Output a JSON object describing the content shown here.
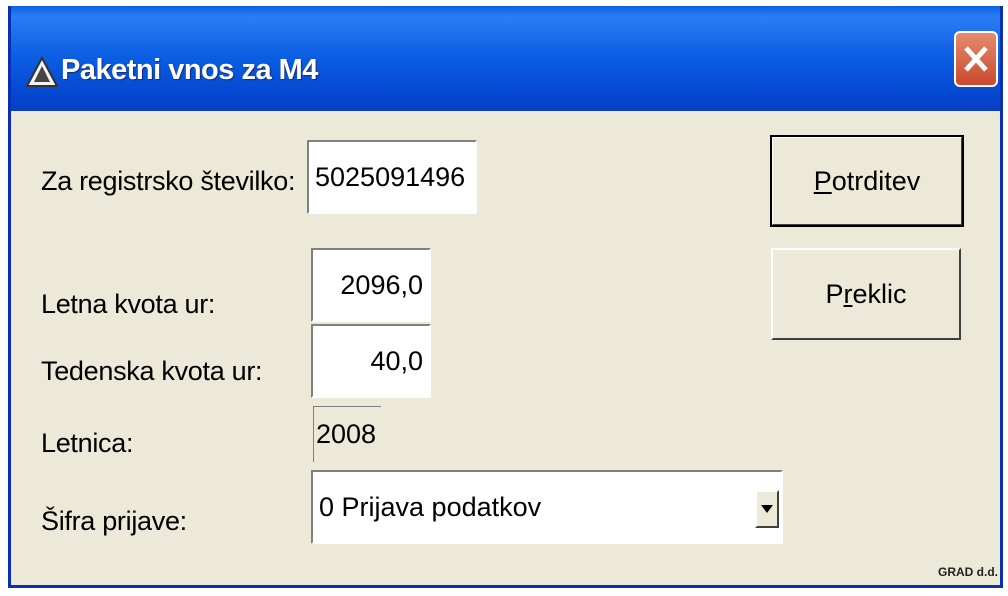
{
  "window": {
    "title": "Paketni vnos za M4",
    "icon": "warning-triangle-icon",
    "close_icon": "close-icon"
  },
  "form": {
    "registration_label": "Za registrsko številko:",
    "registration_value": "5025091496",
    "annual_quota_label": "Letna kvota ur:",
    "annual_quota_value": "2096,0",
    "weekly_quota_label": "Tedenska kvota ur:",
    "weekly_quota_value": "40,0",
    "year_label": "Letnica:",
    "year_value": "2008",
    "code_label": "Šifra prijave:",
    "code_value": "0 Prijava podatkov"
  },
  "buttons": {
    "confirm": "Potrditev",
    "cancel_prefix": "P",
    "cancel_underlined": "r",
    "cancel_suffix": "eklic"
  },
  "watermark": "GRAD d.d."
}
